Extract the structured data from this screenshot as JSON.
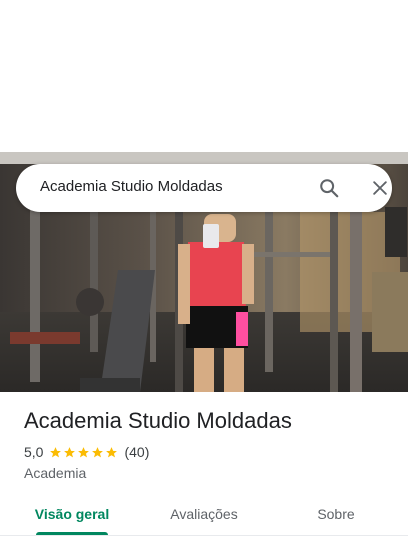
{
  "search": {
    "query": "Academia Studio Moldadas",
    "search_icon": "search-icon",
    "close_icon": "close-icon"
  },
  "place": {
    "photo_icon": "gym-photo",
    "name": "Academia Studio Moldadas",
    "rating": "5,0",
    "stars": 5,
    "reviews": "(40)",
    "category": "Academia"
  },
  "tabs": [
    {
      "label": "Visão geral",
      "active": true
    },
    {
      "label": "Avaliações",
      "active": false
    },
    {
      "label": "Sobre",
      "active": false
    }
  ],
  "colors": {
    "accent": "#01875f",
    "star": "#fbbc04"
  }
}
